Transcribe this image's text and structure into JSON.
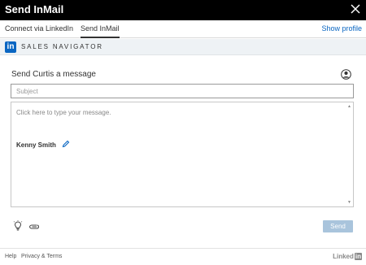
{
  "window": {
    "title": "Send InMail",
    "close_icon": "close-icon"
  },
  "tabs": [
    {
      "label": "Connect via LinkedIn",
      "active": false
    },
    {
      "label": "Send InMail",
      "active": true
    }
  ],
  "header": {
    "show_profile_label": "Show profile"
  },
  "brand": {
    "logo_text": "in",
    "name": "SALES NAVIGATOR",
    "logo_color": "#0a66c2"
  },
  "compose": {
    "heading": "Send Curtis a message",
    "person_icon": "person-icon",
    "subject_placeholder": "Subject",
    "message_placeholder": "Click here to type your message.",
    "signature": "Kenny Smith",
    "send_label": "Send",
    "send_button_color": "#a9c4dc"
  },
  "footer": {
    "help_label": "Help",
    "privacy_label": "Privacy & Terms",
    "logo_text": "Linked",
    "logo_in": "in"
  }
}
